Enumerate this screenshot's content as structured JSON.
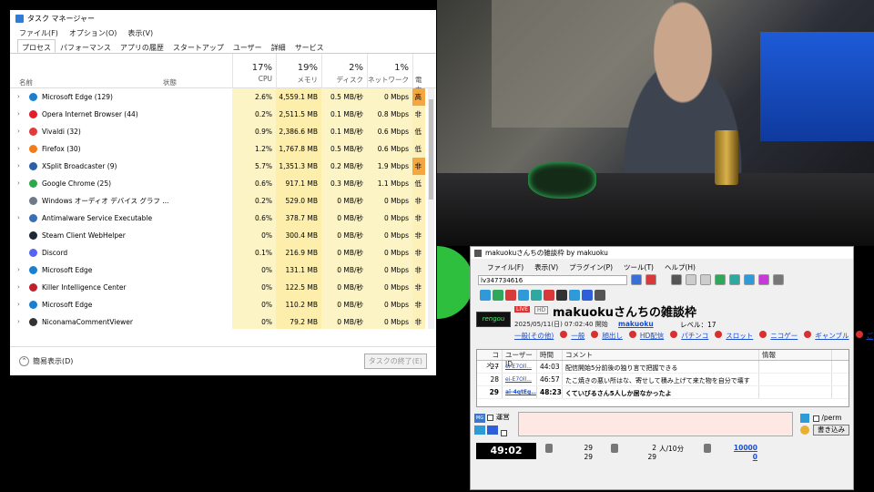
{
  "taskmgr": {
    "title": "タスク マネージャー",
    "menu": [
      "ファイル(F)",
      "オプション(O)",
      "表示(V)"
    ],
    "tabs": [
      "プロセス",
      "パフォーマンス",
      "アプリの履歴",
      "スタートアップ",
      "ユーザー",
      "詳細",
      "サービス"
    ],
    "header": {
      "name": "名前",
      "status": "状態",
      "cpu_pct": "17%",
      "cpu": "CPU",
      "mem_pct": "19%",
      "mem": "メモリ",
      "disk_pct": "2%",
      "disk": "ディスク",
      "net_pct": "1%",
      "net": "ネットワーク",
      "power": "電力"
    },
    "rows": [
      {
        "name": "Microsoft Edge (129)",
        "cpu": "2.6%",
        "mem": "4,559.1 MB",
        "disk": "0.5 MB/秒",
        "net": "0 Mbps",
        "pow": "高",
        "icon": "#1b7fd0",
        "exp": true
      },
      {
        "name": "Opera Internet Browser (44)",
        "cpu": "0.2%",
        "mem": "2,511.5 MB",
        "disk": "0.1 MB/秒",
        "net": "0.8 Mbps",
        "pow": "非",
        "icon": "#e0202a",
        "exp": true
      },
      {
        "name": "Vivaldi (32)",
        "cpu": "0.9%",
        "mem": "2,386.6 MB",
        "disk": "0.1 MB/秒",
        "net": "0.6 Mbps",
        "pow": "低",
        "icon": "#e23a3a",
        "exp": true
      },
      {
        "name": "Firefox (30)",
        "cpu": "1.2%",
        "mem": "1,767.8 MB",
        "disk": "0.5 MB/秒",
        "net": "0.6 Mbps",
        "pow": "低",
        "icon": "#f27b1a",
        "exp": true
      },
      {
        "name": "XSplit Broadcaster (9)",
        "cpu": "5.7%",
        "mem": "1,351.3 MB",
        "disk": "0.2 MB/秒",
        "net": "1.9 Mbps",
        "pow": "非",
        "icon": "#2b5fa8",
        "exp": true
      },
      {
        "name": "Google Chrome (25)",
        "cpu": "0.6%",
        "mem": "917.1 MB",
        "disk": "0.3 MB/秒",
        "net": "1.1 Mbps",
        "pow": "低",
        "icon": "#2ea84d",
        "exp": true
      },
      {
        "name": "Windows オーディオ デバイス グラフ ...",
        "cpu": "0.2%",
        "mem": "529.0 MB",
        "disk": "0 MB/秒",
        "net": "0 Mbps",
        "pow": "非",
        "icon": "#6c7a8a",
        "exp": false
      },
      {
        "name": "Antimalware Service Executable",
        "cpu": "0.6%",
        "mem": "378.7 MB",
        "disk": "0 MB/秒",
        "net": "0 Mbps",
        "pow": "非",
        "icon": "#3b6fb5",
        "exp": true
      },
      {
        "name": "Steam Client WebHelper",
        "cpu": "0%",
        "mem": "300.4 MB",
        "disk": "0 MB/秒",
        "net": "0 Mbps",
        "pow": "非",
        "icon": "#1b2838",
        "exp": false
      },
      {
        "name": "Discord",
        "cpu": "0.1%",
        "mem": "216.9 MB",
        "disk": "0 MB/秒",
        "net": "0 Mbps",
        "pow": "非",
        "icon": "#5865f2",
        "exp": false
      },
      {
        "name": "Microsoft Edge",
        "cpu": "0%",
        "mem": "131.1 MB",
        "disk": "0 MB/秒",
        "net": "0 Mbps",
        "pow": "非",
        "icon": "#1b7fd0",
        "exp": true
      },
      {
        "name": "Killer Intelligence Center",
        "cpu": "0%",
        "mem": "122.5 MB",
        "disk": "0 MB/秒",
        "net": "0 Mbps",
        "pow": "非",
        "icon": "#c0202a",
        "exp": true
      },
      {
        "name": "Microsoft Edge",
        "cpu": "0%",
        "mem": "110.2 MB",
        "disk": "0 MB/秒",
        "net": "0 Mbps",
        "pow": "非",
        "icon": "#1b7fd0",
        "exp": true
      },
      {
        "name": "NiconamaCommentViewer",
        "cpu": "0%",
        "mem": "79.2 MB",
        "disk": "0 MB/秒",
        "net": "0 Mbps",
        "pow": "非",
        "icon": "#333333",
        "exp": true
      }
    ],
    "footer": {
      "fewer": "簡易表示(D)",
      "end_task": "タスクの終了(E)"
    }
  },
  "viewer": {
    "title": "makuokuさんちの雑談枠 by makuoku",
    "menu": [
      "ファイル(F)",
      "表示(V)",
      "プラグイン(P)",
      "ツール(T)",
      "ヘルプ(H)"
    ],
    "url": "lv347734616",
    "thumb_text": "rengou",
    "live": "LIVE",
    "hd": "HD",
    "program_title": "makuokuさんちの雑談枠",
    "start": "2025/05/11(日) 07:02:40 開始",
    "owner": "makuoku",
    "level": "レベル：17",
    "tags": [
      "一般(その他)",
      "一般",
      "顔出し",
      "HD配信",
      "パチンコ",
      "スロット",
      "ニコゲー",
      "ギャンブル",
      "ご"
    ],
    "table_header": {
      "no": "コメ...",
      "uid": "ユーザーID",
      "time": "時間",
      "comment": "コメント",
      "info": "情報"
    },
    "comments": [
      {
        "no": "27",
        "uid": "ei-E7Oll...",
        "time": "44:03",
        "comment": "配信開始5分前後の独り言で把握できる",
        "bold": false
      },
      {
        "no": "28",
        "uid": "ei-E7Oll...",
        "time": "46:57",
        "comment": "たこ焼きの悪い所はな、寄せして積み上げて来た物を自分で壊す",
        "bold": false
      },
      {
        "no": "29",
        "uid": "ai-4qtEg...",
        "time": "48:23",
        "comment": "くていびるさん5人しか居なかったよ",
        "bold": true
      }
    ],
    "operator": "運営",
    "perm": "/perm",
    "write": "書き込み",
    "elapsed": "49:02",
    "stats": {
      "comments_top": "29",
      "comments_bot": "29",
      "viewers_top": "2",
      "viewers_bot": "29",
      "rate": "人/10分",
      "points_top": "10000",
      "points_bot": "0"
    }
  }
}
